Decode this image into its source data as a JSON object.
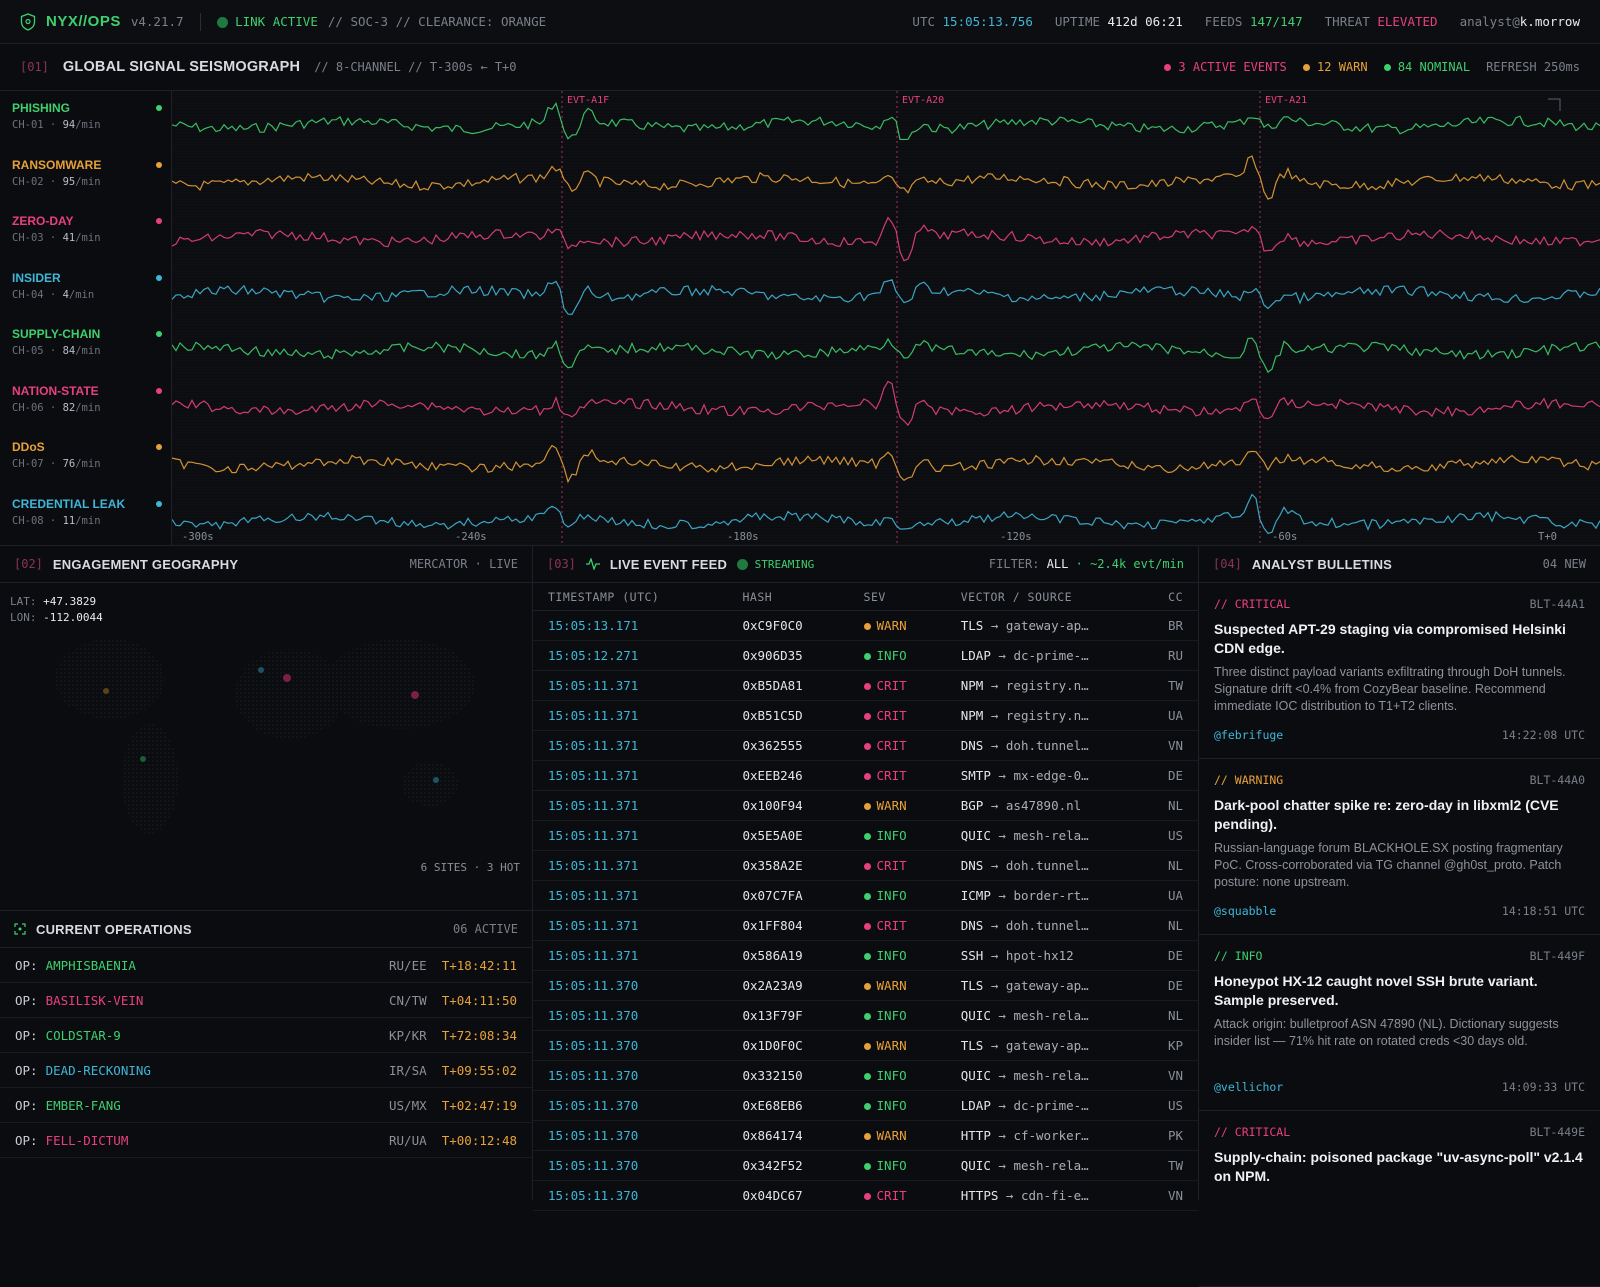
{
  "topbar": {
    "brand": "NYX//OPS",
    "version": "v4.21.7",
    "link": "LINK ACTIVE",
    "soc": "// SOC-3 // CLEARANCE: ORANGE",
    "utc_label": "UTC",
    "utc_value": "15:05:13.756",
    "uptime_label": "UPTIME",
    "uptime_value": "412d 06:21",
    "feeds_label": "FEEDS",
    "feeds_value": "147/147",
    "threat_label": "THREAT",
    "threat_value": "ELEVATED",
    "user_prefix": "analyst@",
    "user_name": "k.morrow"
  },
  "seismograph": {
    "index": "[01]",
    "title": "GLOBAL SIGNAL SEISMOGRAPH",
    "meta": "// 8-CHANNEL // T-300s ← T+0",
    "active_events": "3 ACTIVE EVENTS",
    "warn": "12 WARN",
    "nominal": "84 NOMINAL",
    "refresh": "REFRESH 250ms",
    "events": [
      "EVT-A1F",
      "EVT-A20",
      "EVT-A21"
    ],
    "time_ticks": [
      "-300s",
      "-240s",
      "-180s",
      "-120s",
      "-60s",
      "T+0"
    ],
    "channels": [
      {
        "name": "PHISHING",
        "id": "CH-01",
        "rate": "94",
        "unit": "/min",
        "color": "#3ecf6e"
      },
      {
        "name": "RANSOMWARE",
        "id": "CH-02",
        "rate": "95",
        "unit": "/min",
        "color": "#e8a13a"
      },
      {
        "name": "ZERO-DAY",
        "id": "CH-03",
        "rate": "41",
        "unit": "/min",
        "color": "#e8407f"
      },
      {
        "name": "INSIDER",
        "id": "CH-04",
        "rate": "4",
        "unit": "/min",
        "color": "#3fb6d8"
      },
      {
        "name": "SUPPLY-CHAIN",
        "id": "CH-05",
        "rate": "84",
        "unit": "/min",
        "color": "#3ecf6e"
      },
      {
        "name": "NATION-STATE",
        "id": "CH-06",
        "rate": "82",
        "unit": "/min",
        "color": "#e8407f"
      },
      {
        "name": "DDoS",
        "id": "CH-07",
        "rate": "76",
        "unit": "/min",
        "color": "#e8a13a"
      },
      {
        "name": "CREDENTIAL LEAK",
        "id": "CH-08",
        "rate": "11",
        "unit": "/min",
        "color": "#3fb6d8"
      }
    ]
  },
  "geo": {
    "index": "[02]",
    "title": "ENGAGEMENT GEOGRAPHY",
    "mode": "MERCATOR · LIVE",
    "lat_label": "LAT:",
    "lat": "+47.3829",
    "lon_label": "LON:",
    "lon": "-112.0044",
    "sites": "6 SITES · 3 HOT"
  },
  "ops": {
    "title": "CURRENT OPERATIONS",
    "count": "06 ACTIVE",
    "prefix": "OP:",
    "items": [
      {
        "name": "AMPHISBAENIA",
        "region": "RU/EE",
        "time": "T+18:42:11",
        "color": "#3ecf6e"
      },
      {
        "name": "BASILISK-VEIN",
        "region": "CN/TW",
        "time": "T+04:11:50",
        "color": "#e8407f"
      },
      {
        "name": "COLDSTAR-9",
        "region": "KP/KR",
        "time": "T+72:08:34",
        "color": "#3ecf6e"
      },
      {
        "name": "DEAD-RECKONING",
        "region": "IR/SA",
        "time": "T+09:55:02",
        "color": "#3fb6d8"
      },
      {
        "name": "EMBER-FANG",
        "region": "US/MX",
        "time": "T+02:47:19",
        "color": "#3ecf6e"
      },
      {
        "name": "FELL-DICTUM",
        "region": "RU/UA",
        "time": "T+00:12:48",
        "color": "#e8407f"
      }
    ]
  },
  "feed": {
    "index": "[03]",
    "title": "LIVE EVENT FEED",
    "status": "STREAMING",
    "filter_label": "FILTER:",
    "filter_value": "ALL",
    "rate": "· ~2.4k evt/min",
    "columns": [
      "TIMESTAMP (UTC)",
      "HASH",
      "SEV",
      "VECTOR / SOURCE",
      "CC"
    ],
    "rows": [
      {
        "ts": "15:05:13.171",
        "hash": "0xC9F0C0",
        "sev": "WARN",
        "proto": "TLS",
        "src": "→ gateway-ap…",
        "cc": "BR"
      },
      {
        "ts": "15:05:12.271",
        "hash": "0x906D35",
        "sev": "INFO",
        "proto": "LDAP",
        "src": "→ dc-prime-…",
        "cc": "RU"
      },
      {
        "ts": "15:05:11.371",
        "hash": "0xB5DA81",
        "sev": "CRIT",
        "proto": "NPM",
        "src": "→ registry.n…",
        "cc": "TW"
      },
      {
        "ts": "15:05:11.371",
        "hash": "0xB51C5D",
        "sev": "CRIT",
        "proto": "NPM",
        "src": "→ registry.n…",
        "cc": "UA"
      },
      {
        "ts": "15:05:11.371",
        "hash": "0x362555",
        "sev": "CRIT",
        "proto": "DNS",
        "src": "→ doh.tunnel…",
        "cc": "VN"
      },
      {
        "ts": "15:05:11.371",
        "hash": "0xEEB246",
        "sev": "CRIT",
        "proto": "SMTP",
        "src": "→ mx-edge-0…",
        "cc": "DE"
      },
      {
        "ts": "15:05:11.371",
        "hash": "0x100F94",
        "sev": "WARN",
        "proto": "BGP",
        "src": "→ as47890.nl",
        "cc": "NL"
      },
      {
        "ts": "15:05:11.371",
        "hash": "0x5E5A0E",
        "sev": "INFO",
        "proto": "QUIC",
        "src": "→ mesh-rela…",
        "cc": "US"
      },
      {
        "ts": "15:05:11.371",
        "hash": "0x358A2E",
        "sev": "CRIT",
        "proto": "DNS",
        "src": "→ doh.tunnel…",
        "cc": "NL"
      },
      {
        "ts": "15:05:11.371",
        "hash": "0x07C7FA",
        "sev": "INFO",
        "proto": "ICMP",
        "src": "→ border-rt…",
        "cc": "UA"
      },
      {
        "ts": "15:05:11.371",
        "hash": "0x1FF804",
        "sev": "CRIT",
        "proto": "DNS",
        "src": "→ doh.tunnel…",
        "cc": "NL"
      },
      {
        "ts": "15:05:11.371",
        "hash": "0x586A19",
        "sev": "INFO",
        "proto": "SSH",
        "src": "→ hpot-hx12",
        "cc": "DE"
      },
      {
        "ts": "15:05:11.370",
        "hash": "0x2A23A9",
        "sev": "WARN",
        "proto": "TLS",
        "src": "→ gateway-ap…",
        "cc": "DE"
      },
      {
        "ts": "15:05:11.370",
        "hash": "0x13F79F",
        "sev": "INFO",
        "proto": "QUIC",
        "src": "→ mesh-rela…",
        "cc": "NL"
      },
      {
        "ts": "15:05:11.370",
        "hash": "0x1D0F0C",
        "sev": "WARN",
        "proto": "TLS",
        "src": "→ gateway-ap…",
        "cc": "KP"
      },
      {
        "ts": "15:05:11.370",
        "hash": "0x332150",
        "sev": "INFO",
        "proto": "QUIC",
        "src": "→ mesh-rela…",
        "cc": "VN"
      },
      {
        "ts": "15:05:11.370",
        "hash": "0xE68EB6",
        "sev": "INFO",
        "proto": "LDAP",
        "src": "→ dc-prime-…",
        "cc": "US"
      },
      {
        "ts": "15:05:11.370",
        "hash": "0x864174",
        "sev": "WARN",
        "proto": "HTTP",
        "src": "→ cf-worker…",
        "cc": "PK"
      },
      {
        "ts": "15:05:11.370",
        "hash": "0x342F52",
        "sev": "INFO",
        "proto": "QUIC",
        "src": "→ mesh-rela…",
        "cc": "TW"
      },
      {
        "ts": "15:05:11.370",
        "hash": "0x04DC67",
        "sev": "CRIT",
        "proto": "HTTPS",
        "src": "→ cdn-fi-e…",
        "cc": "VN"
      }
    ]
  },
  "bulletins": {
    "index": "[04]",
    "title": "ANALYST BULLETINS",
    "count": "04 NEW",
    "items": [
      {
        "level": "// CRITICAL",
        "id": "BLT-44A1",
        "title": "Suspected APT-29 staging via compromised Helsinki CDN edge.",
        "body": "Three distinct payload variants exfiltrating through DoH tunnels. Signature drift <0.4% from CozyBear baseline. Recommend immediate IOC distribution to T1+T2 clients.",
        "author": "@febrifuge",
        "time": "14:22:08 UTC",
        "color": "#e8407f"
      },
      {
        "level": "// WARNING",
        "id": "BLT-44A0",
        "title": "Dark-pool chatter spike re: zero-day in libxml2 (CVE pending).",
        "body": "Russian-language forum BLACKHOLE.SX posting fragmentary PoC. Cross-corroborated via TG channel @gh0st_proto. Patch posture: none upstream.",
        "author": "@squabble",
        "time": "14:18:51 UTC",
        "color": "#e8a13a"
      },
      {
        "level": "// INFO",
        "id": "BLT-449F",
        "title": "Honeypot HX-12 caught novel SSH brute variant. Sample preserved.",
        "body": "Attack origin: bulletproof ASN 47890 (NL). Dictionary suggests insider list — 71% hit rate on rotated creds <30 days old.",
        "author": "@vellichor",
        "time": "14:09:33 UTC",
        "color": "#3ecf6e"
      },
      {
        "level": "// CRITICAL",
        "id": "BLT-449E",
        "title": "Supply-chain: poisoned package \"uv-async-poll\" v2.1.4 on NPM.",
        "body": "",
        "author": "",
        "time": "",
        "color": "#e8407f"
      }
    ]
  },
  "colors": {
    "green": "#3ecf6e",
    "amber": "#e8a13a",
    "pink": "#e8407f",
    "cyan": "#3fb6d8"
  }
}
